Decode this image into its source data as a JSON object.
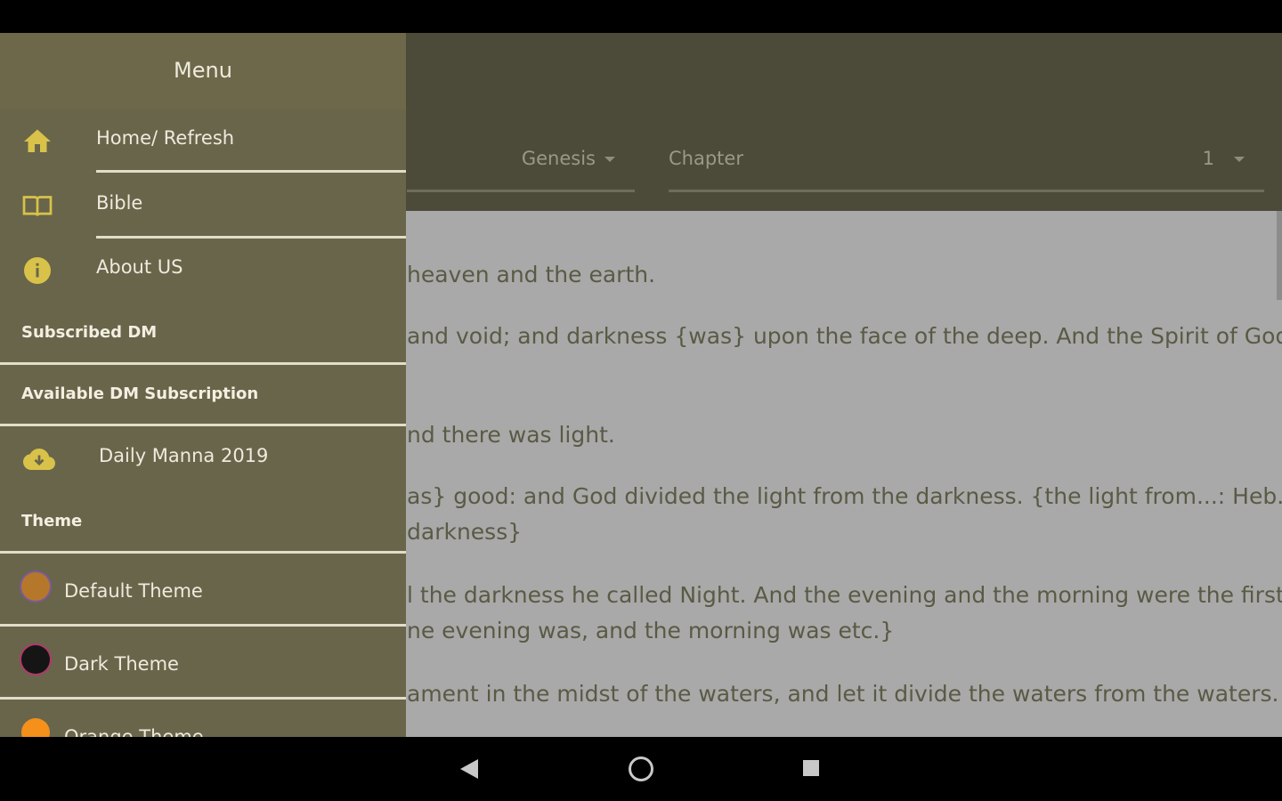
{
  "toolbar": {
    "book": "Genesis",
    "chapter_label": "Chapter",
    "chapter_value": "1"
  },
  "verses": [
    "heaven and the earth.",
    "and void; and darkness {was} upon the face of the deep. And the Spirit of God",
    "nd there was light.",
    "as} good: and God divided the light from the darkness. {the light from...: Heb.",
    "darkness}",
    "l the darkness he called Night. And the evening and the morning were the first",
    "ne evening was, and the morning was etc.}",
    "ament in the midst of the waters, and let it divide the waters from the waters."
  ],
  "drawer": {
    "title": "Menu",
    "nav": [
      {
        "label": "Home/ Refresh",
        "icon": "home-icon"
      },
      {
        "label": "Bible",
        "icon": "book-icon"
      },
      {
        "label": "About US",
        "icon": "info-icon"
      }
    ],
    "subscribed_header": "Subscribed DM",
    "available_header": "Available DM Subscription",
    "subscription": {
      "label": "Daily Manna 2019",
      "icon": "cloud-download-icon"
    },
    "theme_header": "Theme",
    "themes": [
      {
        "label": "Default Theme",
        "color": "#b5782a"
      },
      {
        "label": "Dark Theme",
        "color": "#151515"
      },
      {
        "label": "Orange Theme",
        "color": "#f5901a"
      }
    ]
  },
  "colors": {
    "drawer_bg": "#69654a",
    "toolbar_bg": "#4c4a39",
    "content_bg": "#a9a9a9",
    "accent": "#d8c24a"
  },
  "system_nav": {
    "back": "back-icon",
    "home": "home-circle-icon",
    "recents": "recents-icon"
  }
}
